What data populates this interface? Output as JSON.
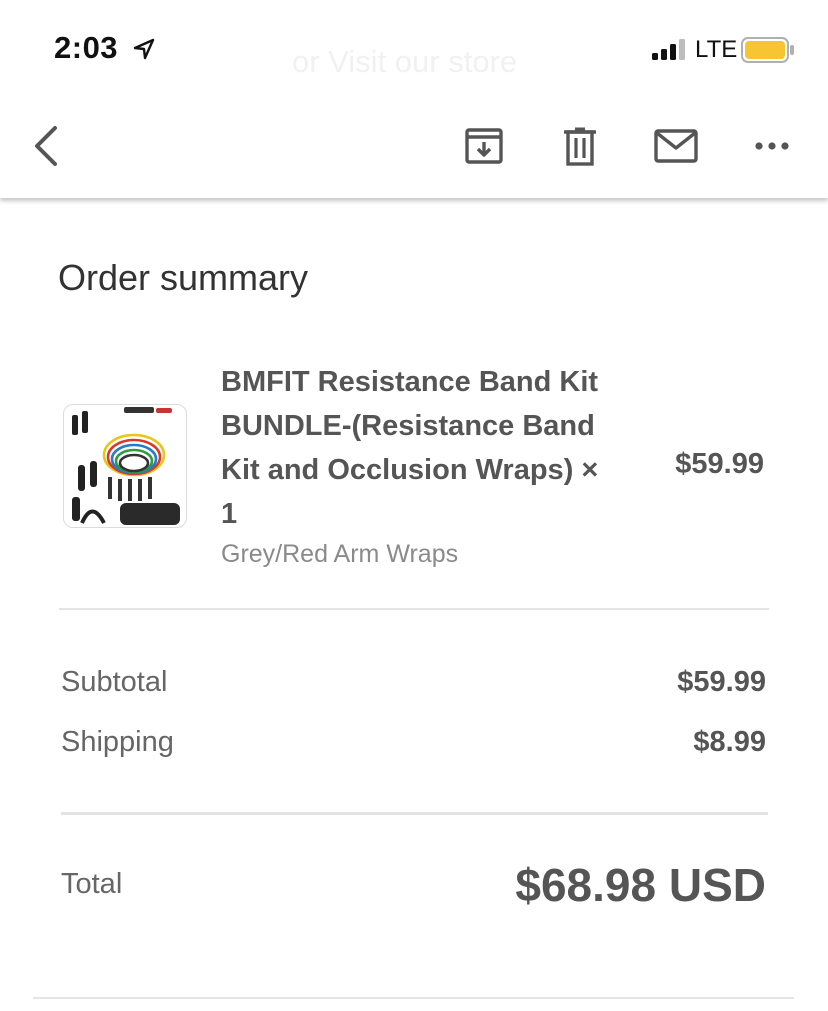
{
  "status_bar": {
    "time": "2:03",
    "ghost_text": "or Visit our store",
    "carrier": "LTE",
    "battery_color": "#f7c531"
  },
  "toolbar": {
    "icons": [
      "back-arrow-icon",
      "archive-icon",
      "trash-icon",
      "mail-icon",
      "more-icon"
    ]
  },
  "order": {
    "title": "Order summary",
    "item": {
      "name": "BMFIT Resistance Band Kit BUNDLE-(Resistance Band Kit and Occlusion Wraps) × 1",
      "variant": "Grey/Red Arm Wraps",
      "price": "$59.99"
    },
    "subtotal_label": "Subtotal",
    "subtotal_value": "$59.99",
    "shipping_label": "Shipping",
    "shipping_value": "$8.99",
    "total_label": "Total",
    "total_value": "$68.98 USD"
  }
}
